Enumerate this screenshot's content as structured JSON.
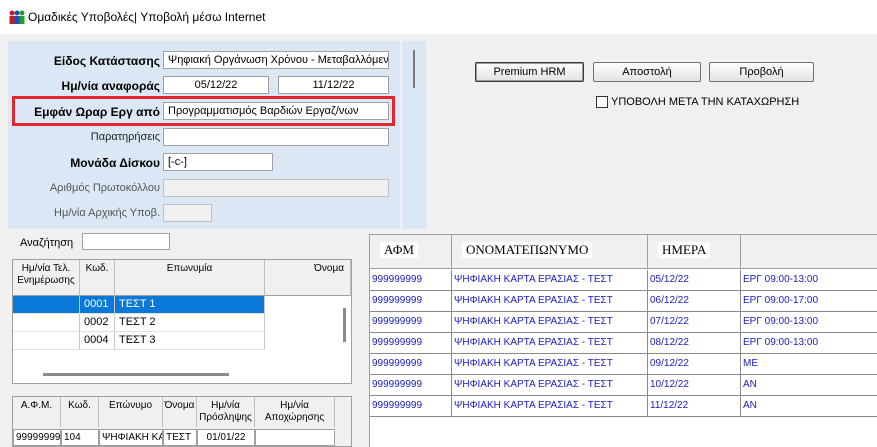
{
  "window": {
    "title": "Ομαδικές Υποβολές| Υποβολή μέσω Internet"
  },
  "form": {
    "eidos_label": "Είδος Κατάστασης",
    "eidos_value": "Ψηφιακή Οργάνωση Χρόνου - Μεταβαλλόμεν",
    "date_label": "Ημ/νία αναφοράς",
    "date_from": "05/12/22",
    "date_to": "11/12/22",
    "emfan_label": "Εμφάν Ωραρ Εργ από",
    "emfan_value": "Προγραμματισμός Βαρδιών Εργαζ/νων",
    "notes_label": "Παρατηρήσεις",
    "notes_value": "",
    "disk_label": "Μονάδα Δίσκου",
    "disk_value": "[-c-]",
    "protocol_label": "Αριθμός Πρωτοκόλλου",
    "initial_label": "Ημ/νία Αρχικής Υποβ."
  },
  "actions": {
    "premium": "Premium HRM",
    "send": "Αποστολή",
    "view": "Προβολή",
    "checkbox_label": "ΥΠΟΒΟΛΗ ΜΕΤΑ ΤΗΝ ΚΑΤΑΧΩΡΗΣΗ"
  },
  "search": {
    "label": "Αναζήτηση",
    "value": ""
  },
  "left_grid": {
    "headers": [
      "Ημ/νία Τελ. Ενημέρωσης",
      "Κωδ.",
      "Επωνυμία",
      "Όνομα"
    ],
    "rows": [
      {
        "date": "",
        "code": "0001",
        "name": "ΤΕΣΤ 1",
        "selected": true
      },
      {
        "date": "",
        "code": "0002",
        "name": "ΤΕΣΤ 2",
        "selected": false
      },
      {
        "date": "",
        "code": "0004",
        "name": "ΤΕΣΤ 3",
        "selected": false
      }
    ]
  },
  "bottom_grid": {
    "headers": [
      "Α.Φ.Μ.",
      "Κωδ.",
      "Επώνυμο",
      "Όνομα",
      "Ημ/νία Πρόσληψης",
      "Ημ/νία Αποχώρησης"
    ],
    "row": [
      "999999999",
      "104",
      "ΨΗΦΙΑΚΗ ΚΑ",
      "ΤΕΣΤ",
      "01/01/22",
      ""
    ]
  },
  "right_grid": {
    "headers": [
      "ΑΦΜ",
      "ΟΝΟΜΑΤΕΠΩΝΥΜΟ",
      "ΗΜΕΡΑ",
      ""
    ],
    "rows": [
      [
        "999999999",
        "ΨΗΦΙΑΚΗ ΚΑΡΤΑ ΕΡΑΣΙΑΣ - ΤΕΣΤ",
        "05/12/22",
        "ΕΡΓ 09:00-13:00"
      ],
      [
        "999999999",
        "ΨΗΦΙΑΚΗ ΚΑΡΤΑ ΕΡΑΣΙΑΣ - ΤΕΣΤ",
        "06/12/22",
        "ΕΡΓ 09:00-17:00"
      ],
      [
        "999999999",
        "ΨΗΦΙΑΚΗ ΚΑΡΤΑ ΕΡΑΣΙΑΣ - ΤΕΣΤ",
        "07/12/22",
        "ΕΡΓ 09:00-13:00"
      ],
      [
        "999999999",
        "ΨΗΦΙΑΚΗ ΚΑΡΤΑ ΕΡΑΣΙΑΣ - ΤΕΣΤ",
        "08/12/22",
        "ΕΡΓ 09:00-13:00"
      ],
      [
        "999999999",
        "ΨΗΦΙΑΚΗ ΚΑΡΤΑ ΕΡΑΣΙΑΣ - ΤΕΣΤ",
        "09/12/22",
        "ΜΕ"
      ],
      [
        "999999999",
        "ΨΗΦΙΑΚΗ ΚΑΡΤΑ ΕΡΑΣΙΑΣ - ΤΕΣΤ",
        "10/12/22",
        "ΑΝ"
      ],
      [
        "999999999",
        "ΨΗΦΙΑΚΗ ΚΑΡΤΑ ΕΡΑΣΙΑΣ - ΤΕΣΤ",
        "11/12/22",
        "ΑΝ"
      ]
    ]
  },
  "colors": {
    "form_bg": "#dbe7f4",
    "highlight": "#e0262e",
    "selection": "#0a78d7",
    "grid_text": "#1a1ac8"
  },
  "icons": {
    "app": "people-group-icon"
  }
}
